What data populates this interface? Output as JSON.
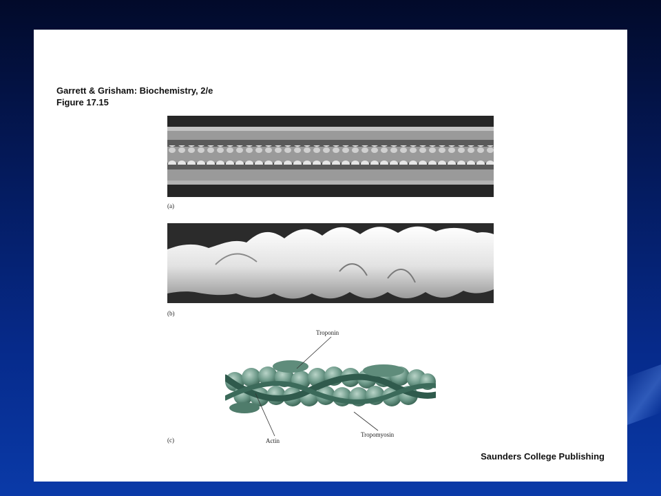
{
  "header": {
    "line1": "Garrett & Grisham: Biochemistry, 2/e",
    "line2": "Figure 17.15"
  },
  "panels": {
    "a_caption": "(a)",
    "b_caption": "(b)",
    "c_caption": "(c)"
  },
  "labels": {
    "troponin": "Troponin",
    "actin": "Actin",
    "tropomyosin": "Tropomyosin"
  },
  "footer": {
    "publisher": "Saunders College Publishing"
  },
  "colors": {
    "background_dark": "#020a2a",
    "background_light": "#0a3aa8",
    "slide": "#ffffff",
    "actin_green": "#6e9a8a",
    "tropomyosin_green": "#2f5a4c"
  }
}
